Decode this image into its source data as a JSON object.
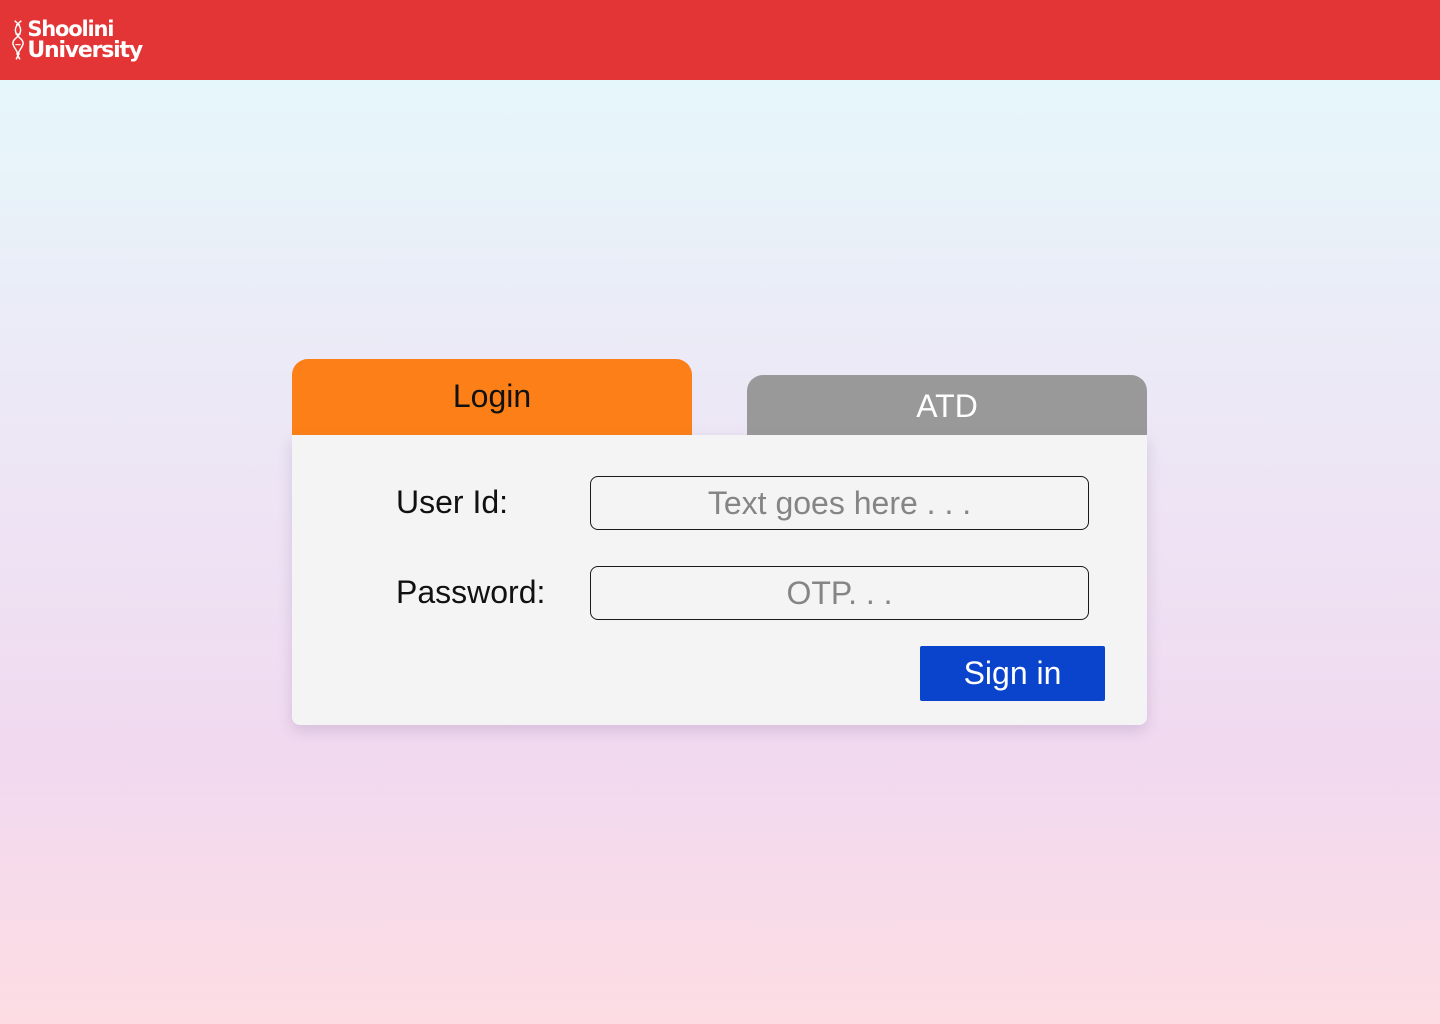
{
  "header": {
    "logo_line1": "Shoolini",
    "logo_line2": "University",
    "logo_icon": "dna-helix-icon",
    "background_color": "#e33535"
  },
  "tabs": [
    {
      "label": "Login",
      "active": true,
      "color": "#fd7f17"
    },
    {
      "label": "ATD",
      "active": false,
      "color": "#999999"
    }
  ],
  "form": {
    "user_id_label": "User Id:",
    "user_id_value": "",
    "user_id_placeholder": "Text goes here . . .",
    "password_label": "Password:",
    "password_value": "",
    "password_placeholder": "OTP. . .",
    "submit_label": "Sign in",
    "submit_color": "#0a44cc"
  }
}
